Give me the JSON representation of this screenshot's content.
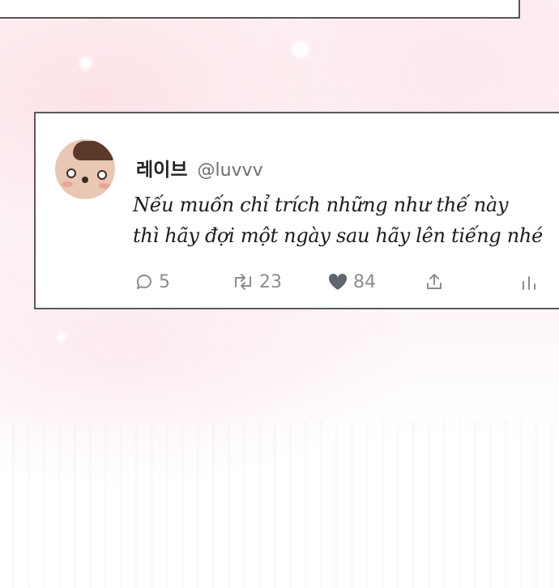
{
  "tweet": {
    "display_name": "레이브",
    "handle": "@luvvv",
    "text_lines": [
      "Nếu muốn chỉ trích những như thế này",
      "thì hãy đợi một ngày sau hãy lên tiếng nhé"
    ],
    "actions": {
      "reply_icon": "reply-bubble-icon",
      "reply_count": "5",
      "retweet_icon": "retweet-icon",
      "retweet_count": "23",
      "like_icon": "heart-icon",
      "like_count": "84",
      "share_icon": "share-upload-icon",
      "analytics_icon": "analytics-bars-icon"
    }
  },
  "colors": {
    "card_border": "#5a5a5a",
    "action_gray": "#8a8d92",
    "heart_fill": "#5f6670",
    "background_pink": "#fdf0f2"
  }
}
